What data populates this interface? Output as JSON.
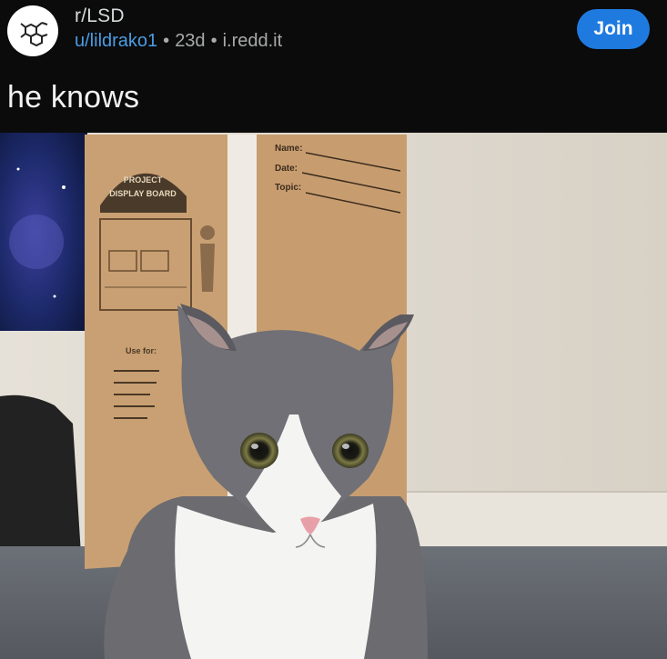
{
  "post": {
    "subreddit": "r/LSD",
    "author": "u/lildrako1",
    "age": "23d",
    "domain": "i.redd.it",
    "title": "he knows",
    "join_label": "Join",
    "separator": "•"
  },
  "box_form": {
    "name_label": "Name:",
    "date_label": "Date:",
    "topic_label": "Topic:",
    "badge_line1": "PROJECT",
    "badge_line2": "DISPLAY BOARD",
    "use_for_label": "Use for:"
  },
  "icons": {
    "subreddit_avatar": "molecule-icon"
  },
  "colors": {
    "background": "#0b0b0b",
    "link_blue": "#4a9de4",
    "join_button": "#1f7ae0",
    "title_text": "#f2f2f2"
  }
}
